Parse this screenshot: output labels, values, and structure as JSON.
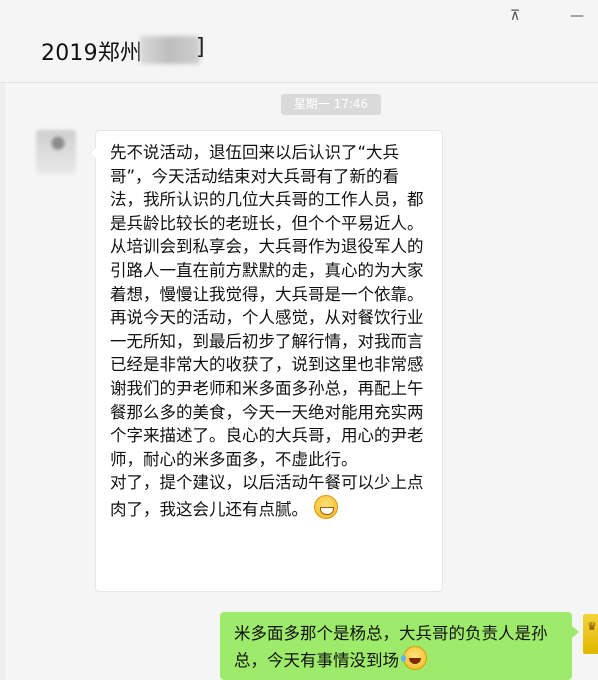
{
  "window": {
    "title": "2019郑州",
    "title_tail": "]",
    "pin_icon": "pin-icon",
    "minimize_icon": "minimize-icon",
    "pin_glyph": "⊼",
    "minimize_glyph": "—"
  },
  "chat": {
    "timestamp": "星期一 17:46",
    "messages": [
      {
        "direction": "incoming",
        "text": "先不说活动，退伍回来以后认识了“大兵哥”，今天活动结束对大兵哥有了新的看法，我所认识的几位大兵哥的工作人员，都是兵龄比较长的老班长，但个个平易近人。从培训会到私享会，大兵哥作为退役军人的引路人一直在前方默默的走，真心的为大家着想，慢慢让我觉得，大兵哥是一个依靠。\n再说今天的活动，个人感觉，从对餐饮行业一无所知，到最后初步了解行情，对我而言已经是非常大的收获了，说到这里也非常感谢我们的尹老师和米多面多孙总，再配上午餐那么多的美食，今天一天绝对能用充实两个字来描述了。良心的大兵哥，用心的尹老师，耐心的米多面多，不虚此行。\n对了，提个建议，以后活动午餐可以少上点肉了，我这会儿还有点腻。",
        "emoji": "grinning-face-icon"
      },
      {
        "direction": "outgoing",
        "text": "米多面多那个是杨总，大兵哥的负责人是孙总，今天有事情没到场",
        "emoji": "tears-of-joy-icon"
      }
    ]
  },
  "colors": {
    "background": "#f5f5f5",
    "incoming_bubble": "#ffffff",
    "outgoing_bubble": "#9eea6a",
    "timestamp_bg": "#dadada"
  }
}
